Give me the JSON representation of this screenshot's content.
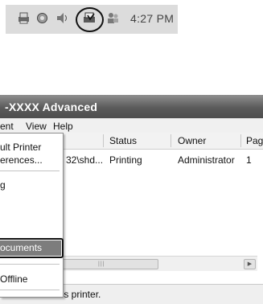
{
  "tray": {
    "icons": [
      "printer-icon",
      "network-icon",
      "volume-icon",
      "printer-status-icon",
      "users-icon"
    ],
    "time": "4:27 PM"
  },
  "window": {
    "title": "-XXXX Advanced",
    "menu": [
      "ent",
      "View",
      "Help"
    ],
    "columns": [
      "Status",
      "Owner",
      "Page"
    ],
    "row": {
      "document": "32\\shd...",
      "status": "Printing",
      "owner": "Administrator",
      "pages": "1"
    },
    "statusbar": "his printer."
  },
  "context_menu": {
    "items": [
      "ult Printer",
      "erences...",
      "g",
      "ocuments",
      "Offline"
    ],
    "highlighted": "ocuments"
  }
}
